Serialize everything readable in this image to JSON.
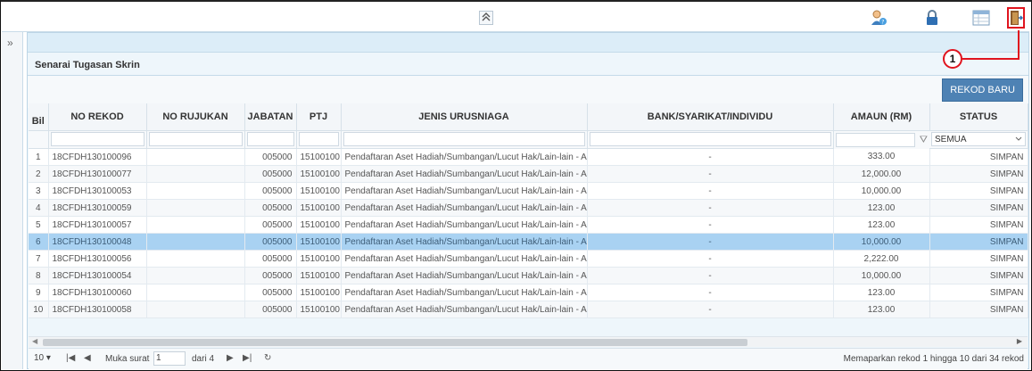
{
  "toolbar": {
    "collapse_icon": "double-chevron-up-icon",
    "icons": [
      "user-help-icon",
      "lock-icon",
      "table-icon",
      "exit-door-icon"
    ]
  },
  "side": {
    "expand_icon": "double-chevron-right-icon",
    "expand_label": "»"
  },
  "panel": {
    "title": "Senarai Tugasan Skrin",
    "new_button": "REKOD BARU"
  },
  "callout": {
    "number": "1"
  },
  "table": {
    "columns": [
      "Bil",
      "NO REKOD",
      "NO RUJUKAN",
      "JABATAN",
      "PTJ",
      "JENIS URUSNIAGA",
      "BANK/SYARIKAT/INDIVIDU",
      "AMAUN (RM)",
      "STATUS"
    ],
    "status_filter": "SEMUA",
    "rows": [
      [
        "1",
        "18CFDH130100096",
        "",
        "005000",
        "15100100",
        "Pendaftaran Aset Hadiah/Sumbangan/Lucut Hak/Lain-lain - A",
        "-",
        "333.00",
        "SIMPAN"
      ],
      [
        "2",
        "18CFDH130100077",
        "",
        "005000",
        "15100100",
        "Pendaftaran Aset Hadiah/Sumbangan/Lucut Hak/Lain-lain - A",
        "-",
        "12,000.00",
        "SIMPAN"
      ],
      [
        "3",
        "18CFDH130100053",
        "",
        "005000",
        "15100100",
        "Pendaftaran Aset Hadiah/Sumbangan/Lucut Hak/Lain-lain - A",
        "-",
        "10,000.00",
        "SIMPAN"
      ],
      [
        "4",
        "18CFDH130100059",
        "",
        "005000",
        "15100100",
        "Pendaftaran Aset Hadiah/Sumbangan/Lucut Hak/Lain-lain - A",
        "-",
        "123.00",
        "SIMPAN"
      ],
      [
        "5",
        "18CFDH130100057",
        "",
        "005000",
        "15100100",
        "Pendaftaran Aset Hadiah/Sumbangan/Lucut Hak/Lain-lain - A",
        "-",
        "123.00",
        "SIMPAN"
      ],
      [
        "6",
        "18CFDH130100048",
        "",
        "005000",
        "15100100",
        "Pendaftaran Aset Hadiah/Sumbangan/Lucut Hak/Lain-lain - A",
        "-",
        "10,000.00",
        "SIMPAN"
      ],
      [
        "7",
        "18CFDH130100056",
        "",
        "005000",
        "15100100",
        "Pendaftaran Aset Hadiah/Sumbangan/Lucut Hak/Lain-lain - A",
        "-",
        "2,222.00",
        "SIMPAN"
      ],
      [
        "8",
        "18CFDH130100054",
        "",
        "005000",
        "15100100",
        "Pendaftaran Aset Hadiah/Sumbangan/Lucut Hak/Lain-lain - A",
        "-",
        "10,000.00",
        "SIMPAN"
      ],
      [
        "9",
        "18CFDH130100060",
        "",
        "005000",
        "15100100",
        "Pendaftaran Aset Hadiah/Sumbangan/Lucut Hak/Lain-lain - A",
        "-",
        "123.00",
        "SIMPAN"
      ],
      [
        "10",
        "18CFDH130100058",
        "",
        "005000",
        "15100100",
        "Pendaftaran Aset Hadiah/Sumbangan/Lucut Hak/Lain-lain - A",
        "-",
        "123.00",
        "SIMPAN"
      ]
    ],
    "selected_row": 6
  },
  "pager": {
    "page_size": "10",
    "page_label": "Muka surat",
    "page_value": "1",
    "of_label": "dari 4",
    "info": "Memaparkan rekod 1 hingga 10 dari 34 rekod"
  },
  "colors": {
    "accent": "#4e82b4",
    "highlight": "#e0141e",
    "selected_row": "#a9d2f2"
  }
}
